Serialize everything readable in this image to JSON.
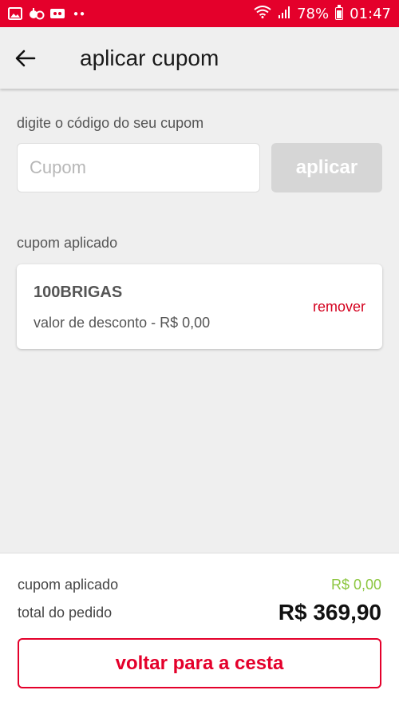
{
  "status_bar": {
    "battery": "78%",
    "time": "01:47",
    "icons": [
      "image-icon",
      "notification-icon",
      "voicemail-icon",
      "more-dots-icon",
      "wifi-icon",
      "signal-icon",
      "battery-icon"
    ]
  },
  "header": {
    "title": "aplicar cupom",
    "back_icon": "arrow-left-icon"
  },
  "coupon_form": {
    "label": "digite o código do seu cupom",
    "input_placeholder": "Cupom",
    "input_value": "",
    "apply_label": "aplicar"
  },
  "applied_section": {
    "label": "cupom aplicado",
    "coupon": {
      "code": "100BRIGAS",
      "discount_text": "valor de desconto - R$ 0,00",
      "remove_label": "remover"
    }
  },
  "footer": {
    "coupon_label": "cupom aplicado",
    "coupon_value": "R$ 0,00",
    "total_label": "total do pedido",
    "total_value": "R$ 369,90",
    "back_button_label": "voltar para a cesta"
  },
  "colors": {
    "brand_red": "#e4002b",
    "discount_green": "#8cc63f",
    "disabled_gray": "#d6d6d6",
    "background": "#efefef"
  }
}
